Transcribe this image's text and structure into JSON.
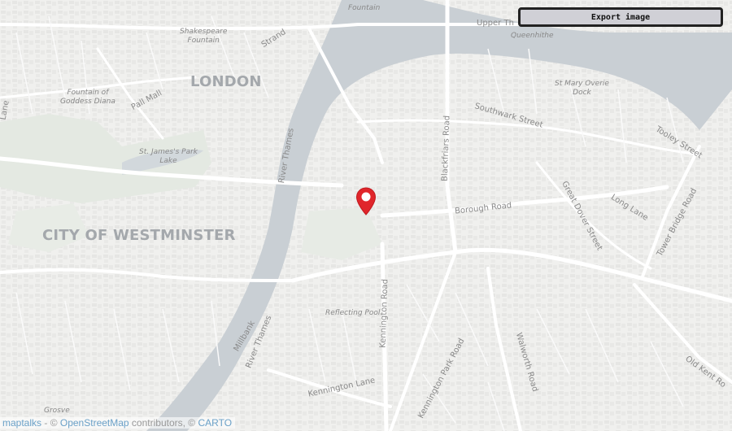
{
  "toolbar": {
    "export_label": "Export image"
  },
  "attribution": {
    "link1": "maptalks",
    "sep1": " - © ",
    "link2": "OpenStreetMap",
    "mid": " contributors, © ",
    "link3": "CARTO"
  },
  "places": {
    "london": "LONDON",
    "westminster": "CITY OF WESTMINSTER"
  },
  "pois": {
    "fountain_top": "Fountain",
    "shakespeare": "Shakespeare\nFountain",
    "diana": "Fountain of\nGoddess Diana",
    "stjames": "St. James's Park\nLake",
    "stmary": "St Mary Overie\nDock",
    "queenhithe": "Queenhithe",
    "reflecting": "Reflecting Pool",
    "grosve": "Grosve"
  },
  "roads": {
    "strand": "Strand",
    "pall_mall": "Pall Mall",
    "upper_thames": "Upper Th",
    "southwark": "Southwark Street",
    "blackfriars": "Blackfriars Road",
    "river_thames1": "River Thames",
    "river_thames2": "River Thames",
    "millbank": "Millbank",
    "borough": "Borough Road",
    "great_dover": "Great Dover Street",
    "long_lane": "Long Lane",
    "tooley": "Tooley Street",
    "tower_bridge": "Tower Bridge Road",
    "kennington_road": "Kennington Road",
    "kennington_park": "Kennington Park Road",
    "kennington_lane": "Kennington Lane",
    "walworth": "Walworth Road",
    "old_kent": "Old Kent Ro",
    "lane": "Lane"
  },
  "colors": {
    "marker": "#e0262b",
    "river": "#c9cfd4",
    "park": "#e6ebe4",
    "road": "#ffffff",
    "accent_bar": "#f0a090"
  },
  "icons": {
    "marker": "map-pin-icon"
  }
}
